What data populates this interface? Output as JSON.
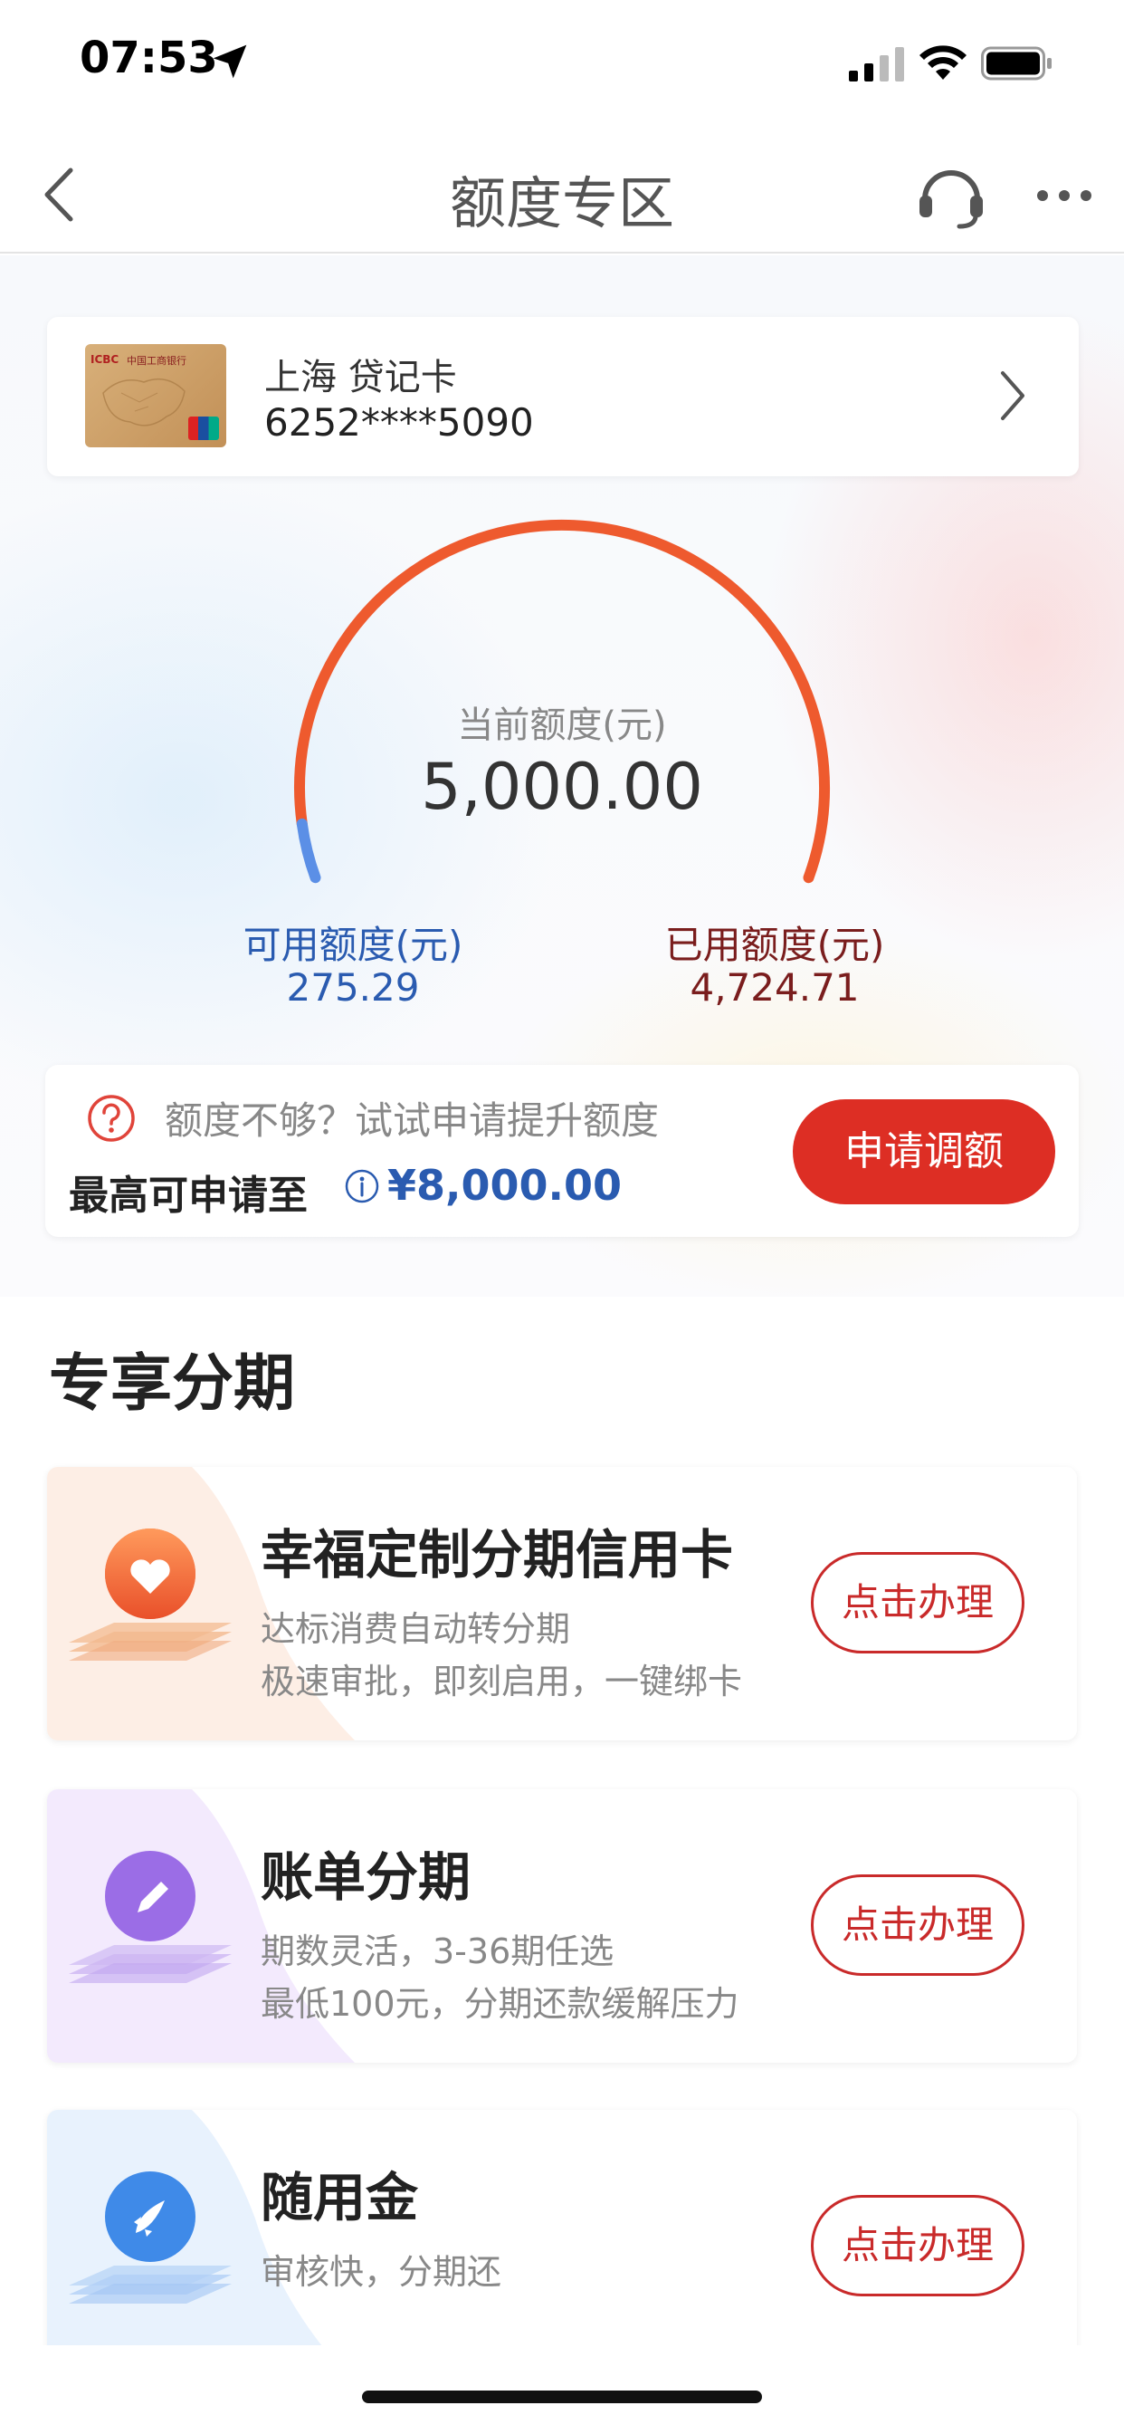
{
  "status_bar": {
    "time": "07:53"
  },
  "nav": {
    "title": "额度专区"
  },
  "card": {
    "name": "上海 贷记卡",
    "number": "6252****5090",
    "thumb_brand": "ICBC",
    "thumb_bank_name": "中国工商银行"
  },
  "credit": {
    "current_label": "当前额度(元)",
    "current_value": "5,000.00",
    "available_label": "可用额度(元)",
    "available_value": "275.29",
    "used_label": "已用额度(元)",
    "used_value": "4,724.71",
    "available_fraction": 0.055,
    "colors": {
      "used_arc": "#ee5a2e",
      "available_arc": "#5b8fe6"
    }
  },
  "upgrade": {
    "hint": "额度不够？试试申请提升额度",
    "max_label": "最高可申请至",
    "max_value": "¥8,000.00",
    "button_label": "申请调额"
  },
  "section": {
    "title": "专享分期"
  },
  "products": [
    {
      "title": "幸福定制分期信用卡",
      "line1": "达标消费自动转分期",
      "line2": "极速审批，即刻启用，一键绑卡",
      "button_label": "点击办理",
      "icon": "heart-icon"
    },
    {
      "title": "账单分期",
      "line1": "期数灵活，3-36期任选",
      "line2": "最低100元，分期还款缓解压力",
      "button_label": "点击办理",
      "icon": "pencil-icon"
    },
    {
      "title": "随用金",
      "line1": "审核快，分期还",
      "line2": "",
      "button_label": "点击办理",
      "icon": "rocket-icon"
    }
  ]
}
